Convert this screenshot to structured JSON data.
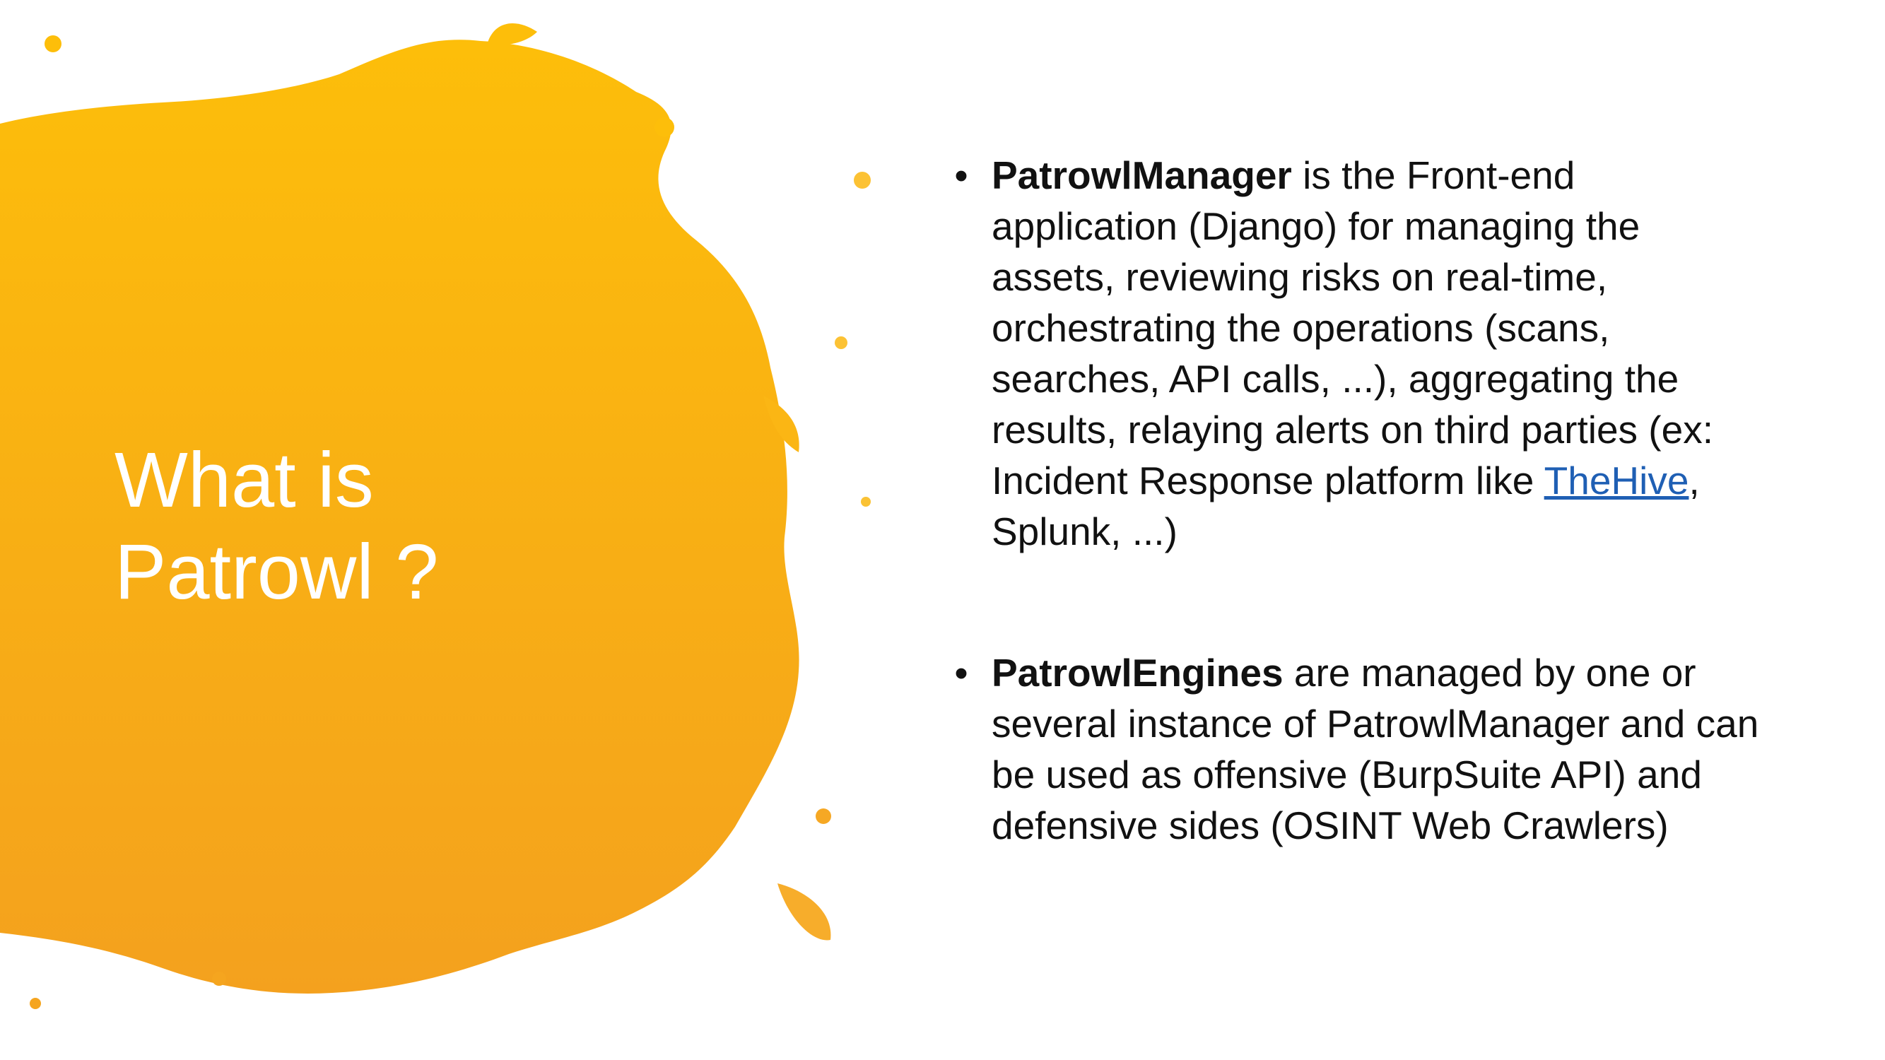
{
  "slide": {
    "title_lines": [
      "What is",
      "Patrowl ?"
    ],
    "bullets": [
      {
        "bold": "PatrowlManager",
        "text_before_link": " is the Front-end application (Django) for managing the assets, reviewing risks on real-time, orchestrating the operations (scans, searches, API calls, ...), aggregating the results, relaying alerts on third parties (ex: Incident Response platform like ",
        "link": "TheHive",
        "text_after_link": ", Splunk, ...)"
      },
      {
        "bold": "PatrowlEngines",
        "text": " are managed by one or several instance of PatrowlManager and can be used as offensive (BurpSuite API) and defensive sides (OSINT Web Crawlers)"
      }
    ],
    "bullet_symbol": "•"
  },
  "colors": {
    "splash_top": "#fdbe0a",
    "splash_bottom": "#f5a51f",
    "title_text": "#ffffff",
    "body_text": "#111111",
    "link": "#1f5fb4"
  }
}
